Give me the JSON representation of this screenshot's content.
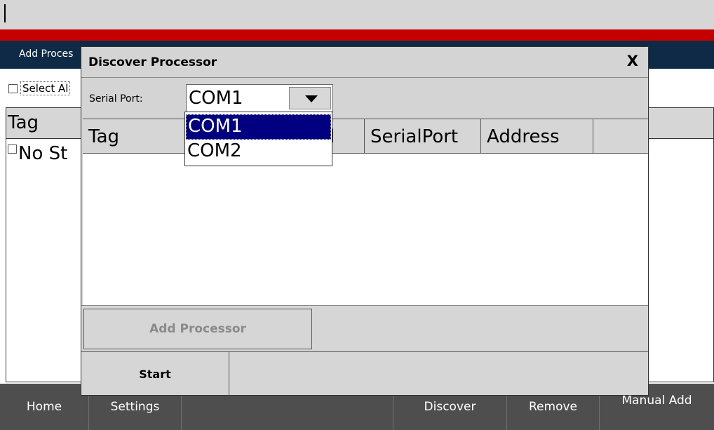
{
  "background": {
    "breadcrumb": "Add Proces",
    "select_all_label": "Select Al",
    "table_header": "Tag",
    "empty_row_text": "No St",
    "bottom_tabs": [
      "Home",
      "Settings",
      "",
      "Discover",
      "Remove",
      "Manual Add"
    ]
  },
  "dialog": {
    "title": "Discover Processor",
    "close_label": "X",
    "serial_port_label": "Serial Port:",
    "selected_port": "COM1",
    "port_options": [
      "COM1",
      "COM2"
    ],
    "columns": [
      "Tag",
      "l",
      "SerialPort",
      "Address",
      ""
    ],
    "add_processor_label": "Add Processor",
    "start_label": "Start"
  },
  "colors": {
    "accent_red": "#c40000",
    "header_navy": "#0e2a47",
    "selection": "#000080",
    "bottom_bar": "#4e4e4e"
  }
}
